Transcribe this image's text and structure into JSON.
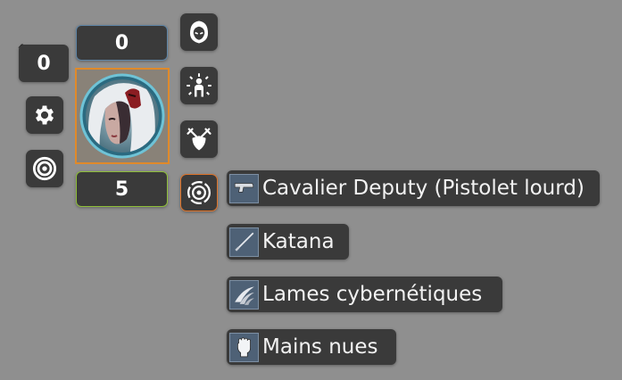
{
  "hud": {
    "elevation_value": "0",
    "bar_top_value": "0",
    "bar_bottom_value": "5",
    "elevation_caret": "^"
  },
  "token": {
    "image": "portrait-silver-haired-cyborg-woman"
  },
  "left_buttons": [
    {
      "icon": "gear-icon"
    },
    {
      "icon": "target-icon"
    }
  ],
  "right_buttons": [
    {
      "icon": "hooded-figure-icon"
    },
    {
      "icon": "aura-figure-icon"
    },
    {
      "icon": "crossed-swords-shield-icon"
    },
    {
      "icon": "target-rings-icon",
      "active": true
    }
  ],
  "weapons": [
    {
      "label": "Cavalier Deputy (Pistolet lourd)",
      "icon": "pistol-icon"
    },
    {
      "label": "Katana",
      "icon": "sword-icon"
    },
    {
      "label": "Lames cybernétiques",
      "icon": "claw-blades-icon"
    },
    {
      "label": "Mains nues",
      "icon": "fist-icon"
    }
  ],
  "colors": {
    "background": "#8f8f8f",
    "panel": "#3a3a3a",
    "bar_top_border": "#5f86a8",
    "bar_bottom_border": "#8fbf3a",
    "token_border": "#e08a2a",
    "active_button_border": "#e0742a",
    "weapon_icon_bg": "#4e6176"
  }
}
